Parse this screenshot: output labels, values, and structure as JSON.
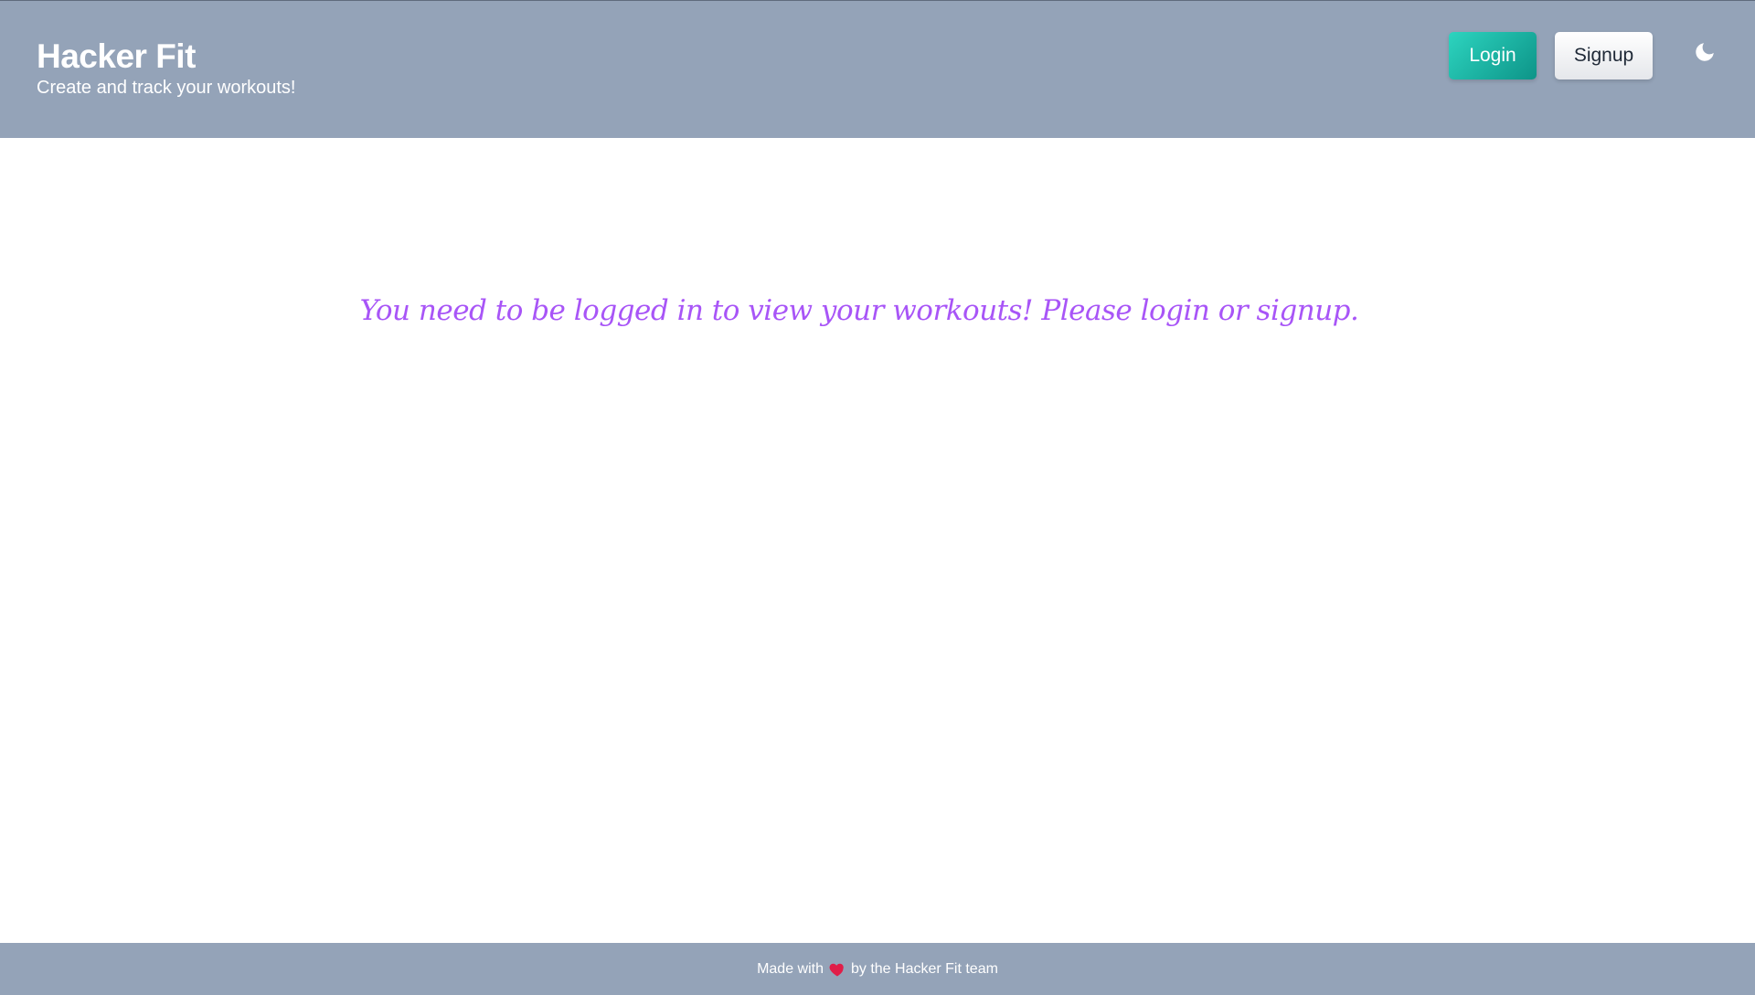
{
  "header": {
    "title": "Hacker Fit",
    "tagline": "Create and track your workouts!",
    "login_label": "Login",
    "signup_label": "Signup",
    "theme_icon": "moon-icon"
  },
  "main": {
    "message": "You need to be logged in to view your workouts! Please login or signup."
  },
  "footer": {
    "text_before": "Made with",
    "icon": "heart-icon",
    "text_after": "by the Hacker Fit team"
  },
  "colors": {
    "header_bg": "#94a3b8",
    "login_accent": "#14b8a6",
    "message": "#a855f7",
    "heart": "#e11d48"
  }
}
